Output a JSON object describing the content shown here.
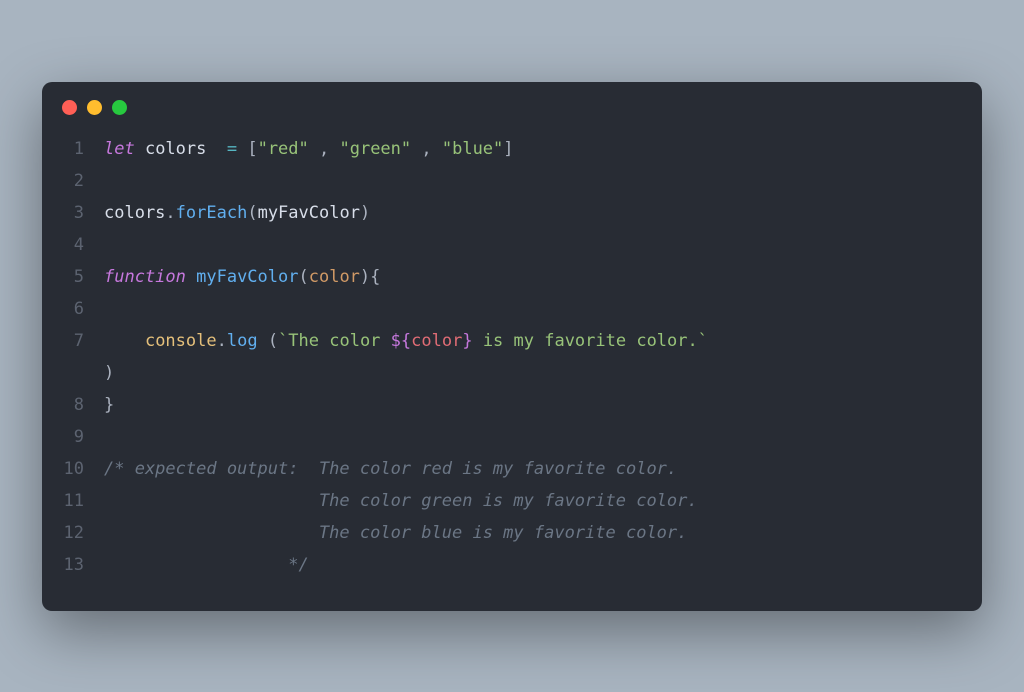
{
  "window": {
    "traffic_lights": [
      "close",
      "minimize",
      "maximize"
    ]
  },
  "code": {
    "lines": [
      {
        "n": "1",
        "tokens": [
          {
            "t": "let ",
            "c": "kw"
          },
          {
            "t": "colors  ",
            "c": "ident"
          },
          {
            "t": "= ",
            "c": "op"
          },
          {
            "t": "[",
            "c": "punct"
          },
          {
            "t": "\"red\"",
            "c": "str"
          },
          {
            "t": " , ",
            "c": "punct"
          },
          {
            "t": "\"green\"",
            "c": "str"
          },
          {
            "t": " , ",
            "c": "punct"
          },
          {
            "t": "\"blue\"",
            "c": "str"
          },
          {
            "t": "]",
            "c": "punct"
          }
        ]
      },
      {
        "n": "2",
        "tokens": []
      },
      {
        "n": "3",
        "tokens": [
          {
            "t": "colors",
            "c": "ident"
          },
          {
            "t": ".",
            "c": "punct"
          },
          {
            "t": "forEach",
            "c": "method"
          },
          {
            "t": "(",
            "c": "punct"
          },
          {
            "t": "myFavColor",
            "c": "ident"
          },
          {
            "t": ")",
            "c": "punct"
          }
        ]
      },
      {
        "n": "4",
        "tokens": []
      },
      {
        "n": "5",
        "tokens": [
          {
            "t": "function ",
            "c": "func"
          },
          {
            "t": "myFavColor",
            "c": "fname"
          },
          {
            "t": "(",
            "c": "punct"
          },
          {
            "t": "color",
            "c": "param"
          },
          {
            "t": ")",
            "c": "punct"
          },
          {
            "t": "{",
            "c": "brace"
          }
        ]
      },
      {
        "n": "6",
        "tokens": []
      },
      {
        "n": "7",
        "tokens": [
          {
            "t": "    ",
            "c": "ident"
          },
          {
            "t": "console",
            "c": "obj"
          },
          {
            "t": ".",
            "c": "punct"
          },
          {
            "t": "log ",
            "c": "method"
          },
          {
            "t": "(",
            "c": "punct"
          },
          {
            "t": "`The color ",
            "c": "tmpl"
          },
          {
            "t": "${",
            "c": "tmplbrace"
          },
          {
            "t": "color",
            "c": "tmplvar"
          },
          {
            "t": "}",
            "c": "tmplbrace"
          },
          {
            "t": " is my favorite color.`",
            "c": "tmpl"
          }
        ]
      },
      {
        "n": "",
        "tokens": [
          {
            "t": ")",
            "c": "punct"
          }
        ]
      },
      {
        "n": "8",
        "tokens": [
          {
            "t": "}",
            "c": "brace"
          }
        ]
      },
      {
        "n": "9",
        "tokens": []
      },
      {
        "n": "10",
        "tokens": [
          {
            "t": "/* expected output:  The color red is my favorite color.",
            "c": "comment"
          }
        ]
      },
      {
        "n": "11",
        "tokens": [
          {
            "t": "                     The color green is my favorite color.",
            "c": "comment"
          }
        ]
      },
      {
        "n": "12",
        "tokens": [
          {
            "t": "                     The color blue is my favorite color.",
            "c": "comment"
          }
        ]
      },
      {
        "n": "13",
        "tokens": [
          {
            "t": "                  */",
            "c": "comment"
          }
        ]
      }
    ]
  }
}
